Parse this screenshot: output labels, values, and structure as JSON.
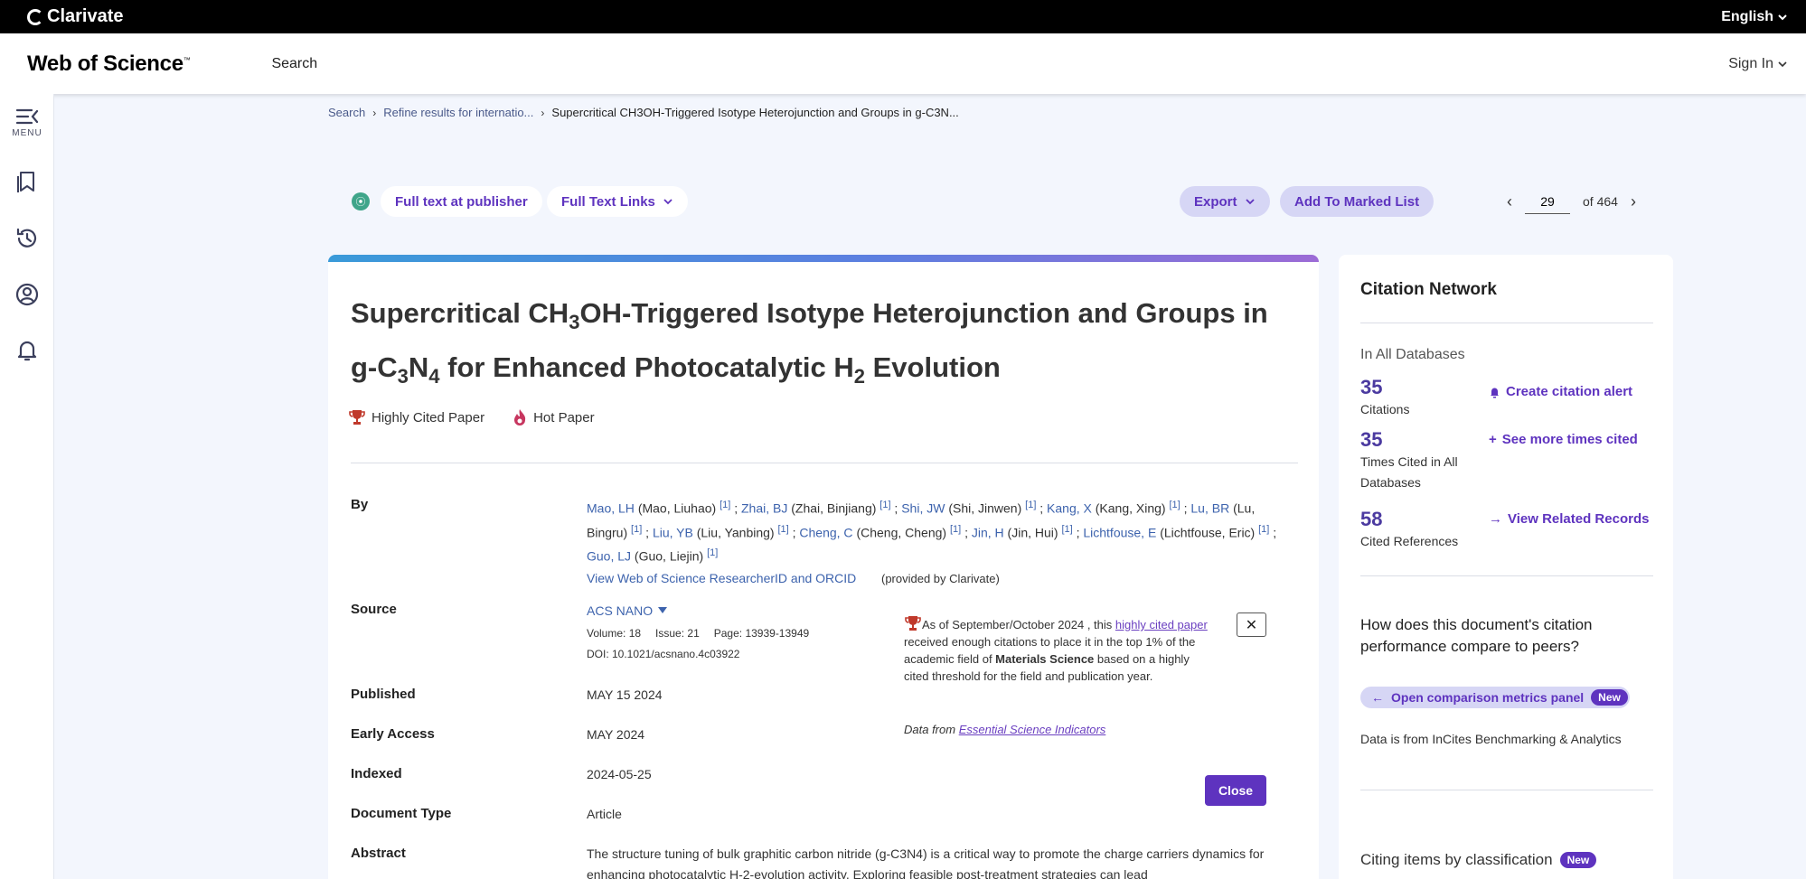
{
  "topbar": {
    "brand": "Clarivate",
    "language": "English"
  },
  "header": {
    "logo": "Web of Science",
    "logo_tm": "™",
    "search": "Search",
    "sign_in": "Sign In"
  },
  "rail": {
    "menu_label": "MENU"
  },
  "breadcrumb": {
    "items": [
      "Search",
      "Refine results for internatio...",
      "Supercritical CH3OH-Triggered Isotype Heterojunction and Groups in g-C3N..."
    ]
  },
  "toolbar": {
    "full_text_publisher": "Full text at publisher",
    "full_text_links": "Full Text Links",
    "export": "Export",
    "add_to_marked_list": "Add To Marked List"
  },
  "pager": {
    "current": "29",
    "of_label": "of",
    "total": "464"
  },
  "record": {
    "title_parts": [
      "Supercritical CH",
      "3",
      "OH-Triggered Isotype Heterojunction and Groups in g-C",
      "3",
      "N",
      "4",
      " for Enhanced Photocatalytic H",
      "2",
      " Evolution"
    ],
    "badges": {
      "highly_cited": "Highly Cited Paper",
      "hot": "Hot Paper"
    },
    "labels": {
      "by": "By",
      "source": "Source",
      "published": "Published",
      "early_access": "Early Access",
      "indexed": "Indexed",
      "document_type": "Document Type",
      "abstract": "Abstract"
    },
    "authors": [
      {
        "short": "Mao, LH",
        "full": "(Mao, Liuhao)",
        "ref": "[1]"
      },
      {
        "short": "Zhai, BJ",
        "full": "(Zhai, Binjiang)",
        "ref": "[1]"
      },
      {
        "short": "Shi, JW",
        "full": "(Shi, Jinwen)",
        "ref": "[1]"
      },
      {
        "short": "Kang, X",
        "full": "(Kang, Xing)",
        "ref": "[1]"
      },
      {
        "short": "Lu, BR",
        "full": "(Lu, Bingru)",
        "ref": "[1]"
      },
      {
        "short": "Liu, YB",
        "full": "(Liu, Yanbing)",
        "ref": "[1]"
      },
      {
        "short": "Cheng, C",
        "full": "(Cheng, Cheng)",
        "ref": "[1]"
      },
      {
        "short": "Jin, H",
        "full": "(Jin, Hui)",
        "ref": "[1]"
      },
      {
        "short": "Lichtfouse, E",
        "full": "(Lichtfouse, Eric)",
        "ref": "[1]"
      },
      {
        "short": "Guo, LJ",
        "full": "(Guo, Liejin)",
        "ref": "[1]"
      }
    ],
    "researcher_link": "View Web of Science ResearcherID and ORCID",
    "researcher_note": "(provided by Clarivate)",
    "source": {
      "journal": "ACS NANO",
      "volume": "Volume: 18",
      "issue": "Issue: 21",
      "pages": "Page: 13939-13949",
      "doi": "DOI: 10.1021/acsnano.4c03922"
    },
    "published": "MAY 15 2024",
    "early_access": "MAY 2024",
    "indexed": "2024-05-25",
    "document_type": "Article",
    "abstract": "The structure tuning of bulk graphitic carbon nitride (g-C3N4) is a critical way to promote the charge carriers dynamics for enhancing photocatalytic H-2-evolution activity. Exploring feasible post-treatment strategies can lead"
  },
  "highly_cited_popup": {
    "text_before": "As of September/October 2024 , this ",
    "link": "highly cited paper",
    "text_mid": " received enough citations to place it in the top 1% of the academic field of ",
    "field": "Materials Science",
    "text_after": " based on a highly cited threshold for the field and publication year.",
    "data_from": "Data from ",
    "data_link": "Essential Science Indicators",
    "close_x": "✕",
    "close_button": "Close"
  },
  "citation_network": {
    "title": "Citation Network",
    "in_all_db": "In All Databases",
    "citations": {
      "value": "35",
      "label": "Citations",
      "action": "Create citation alert"
    },
    "times_cited": {
      "value": "35",
      "label": "Times Cited in All Databases",
      "action": "See more times cited"
    },
    "cited_refs": {
      "value": "58",
      "label": "Cited References",
      "action": "View Related Records"
    },
    "compare_question": "How does this document's citation performance compare to peers?",
    "compare_button": "Open comparison metrics panel",
    "new_tag": "New",
    "data_source": "Data is from InCites Benchmarking & Analytics",
    "citing_items": "Citing items by classification"
  },
  "colors": {
    "accent": "#5e33bf",
    "link": "#3d63ad",
    "background": "#f3f6fd"
  }
}
